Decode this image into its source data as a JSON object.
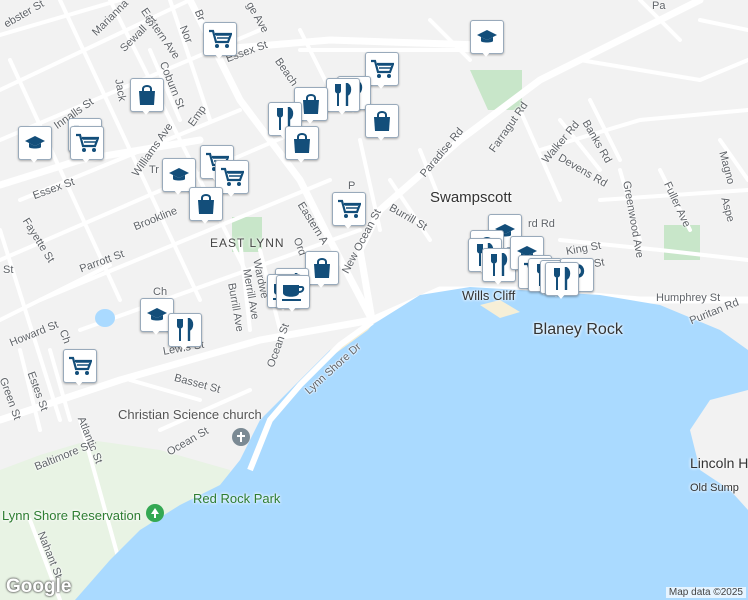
{
  "map": {
    "neighborhood": "EAST LYNN",
    "town": "Swampscott",
    "places": {
      "blaney_rock": "Blaney Rock",
      "wills_cliff": "Wills Cliff",
      "lincoln_house": "Lincoln House P",
      "old_sump": "Old Sump"
    },
    "parks": {
      "red_rock_park": "Red Rock Park",
      "lynn_shore_reservation": "Lynn Shore Reservation"
    },
    "pois": {
      "christian_science_church": "Christian Science church"
    },
    "streets": {
      "essex_st_top": "Essex St",
      "essex_st_left": "Essex St",
      "eastern_ave_top": "Eastern Ave",
      "eastern_ave_mid": "Eastern A",
      "new_ocean_st": "New Ocean St",
      "paradise_rd": "Paradise Rd",
      "farragut_rd": "Farragut Rd",
      "walker_rd": "Walker Rd",
      "banks_rd": "Banks Rd",
      "devens_rd": "Devens Rd",
      "greenwood_ave": "Greenwood Ave",
      "fuller_ave": "Fuller Ave",
      "burrill_st": "Burrill St",
      "burrill_ave": "Burrill Ave",
      "humphrey_st": "Humphrey St",
      "puritan_rd": "Puritan Rd",
      "lynn_shore_dr": "Lynn Shore Dr",
      "lewis_st": "Lewis St",
      "basset_st": "Basset St",
      "ocean_st_a": "Ocean St",
      "ocean_st_b": "Ocean St",
      "merrill_ave": "Merrill Ave",
      "wardwell": "Wardwe",
      "parrott_st": "Parrott St",
      "brookline": "Brookline",
      "fayette_st": "Fayette St",
      "howard_st": "Howard St",
      "green_st": "Green St",
      "estes_st": "Estes St",
      "atlantic_st": "Atlantic St",
      "baltimore_st": "Baltimore St",
      "nahant_st": "Nahant St",
      "innalls_st": "Innalls St",
      "williams_ave": "Williams Ave",
      "coburn_st": "Coburn St",
      "sewall_st": "Sewall St",
      "marianna_st": "Marianna",
      "webster_st": "ebster St",
      "beach": "Beach",
      "jackson": "Jack",
      "king_st": "King St",
      "chatham": "Ch",
      "magnolia": "Magno",
      "aspen": "Aspe",
      "empire": "Emp",
      "tr": "Tr",
      "st_short": "St",
      "chestnut": "Ch",
      "ord": "Ord",
      "p_st": "P",
      "rd_short": "rd Rd",
      "and_st": "and St",
      "pa": "Pa",
      "ge_ave": "ge Ave",
      "no": "Nor",
      "br": "Br"
    },
    "pin_icons": [
      "graduation-cap-icon",
      "shopping-cart-icon",
      "shopping-bag-icon",
      "restaurant-icon",
      "coffee-icon",
      "parking-icon",
      "church-icon",
      "park-icon"
    ],
    "logo": "Google",
    "attribution": "Map data ©2025",
    "colors": {
      "water": "#aadaff",
      "land": "#f2f2f2",
      "road": "#ffffff",
      "major_road": "#ffffff",
      "park": "#c8e6c9",
      "pin_icon": "#134e7a",
      "beach": "#f6efd7"
    }
  }
}
